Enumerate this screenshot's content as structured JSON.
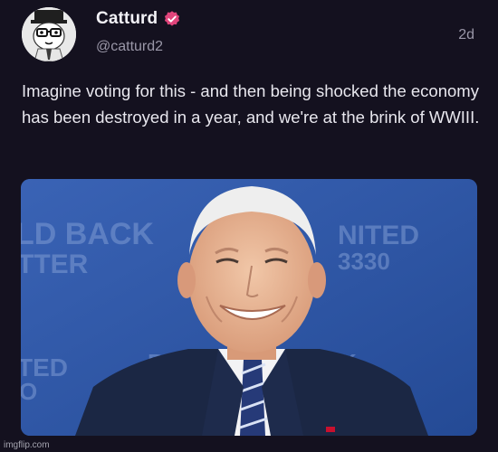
{
  "author": {
    "display_name": "Catturd",
    "handle": "@catturd2",
    "avatar_icon": "cartoon-cat-avatar-icon",
    "verified_icon": "verified-badge-icon",
    "verified_color": "#e0457b"
  },
  "post": {
    "timestamp": "2d",
    "text": "Imagine voting for this - and then being shocked the economy has been destroyed in a year, and we're at the brink of WWIII."
  },
  "media": {
    "backdrop_texts": [
      "LD BACK",
      "TTER",
      "NITED",
      "3330",
      "TED",
      "O",
      "BU",
      "K"
    ]
  },
  "watermark": "imgflip.com",
  "colors": {
    "background": "#14111f",
    "text": "#e8e7ee",
    "muted": "#9a97a8",
    "backdrop_blue": "#2f55a3"
  }
}
